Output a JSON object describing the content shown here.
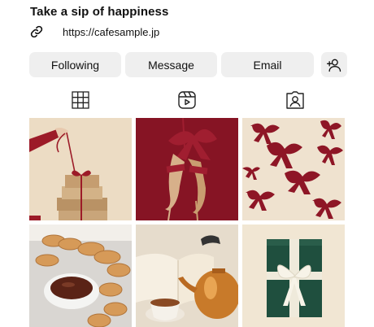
{
  "profile": {
    "headline": "Take a sip of happiness",
    "website": "https://cafesample.jp"
  },
  "actions": {
    "following_label": "Following",
    "message_label": "Message",
    "email_label": "Email",
    "suggest_icon": "add-person-icon"
  },
  "tabs": [
    {
      "icon": "grid-icon"
    },
    {
      "icon": "reels-icon"
    },
    {
      "icon": "tagged-icon"
    }
  ],
  "colors": {
    "button_bg": "#efefef",
    "burgundy": "#7d1324",
    "cream": "#e6d6be"
  }
}
